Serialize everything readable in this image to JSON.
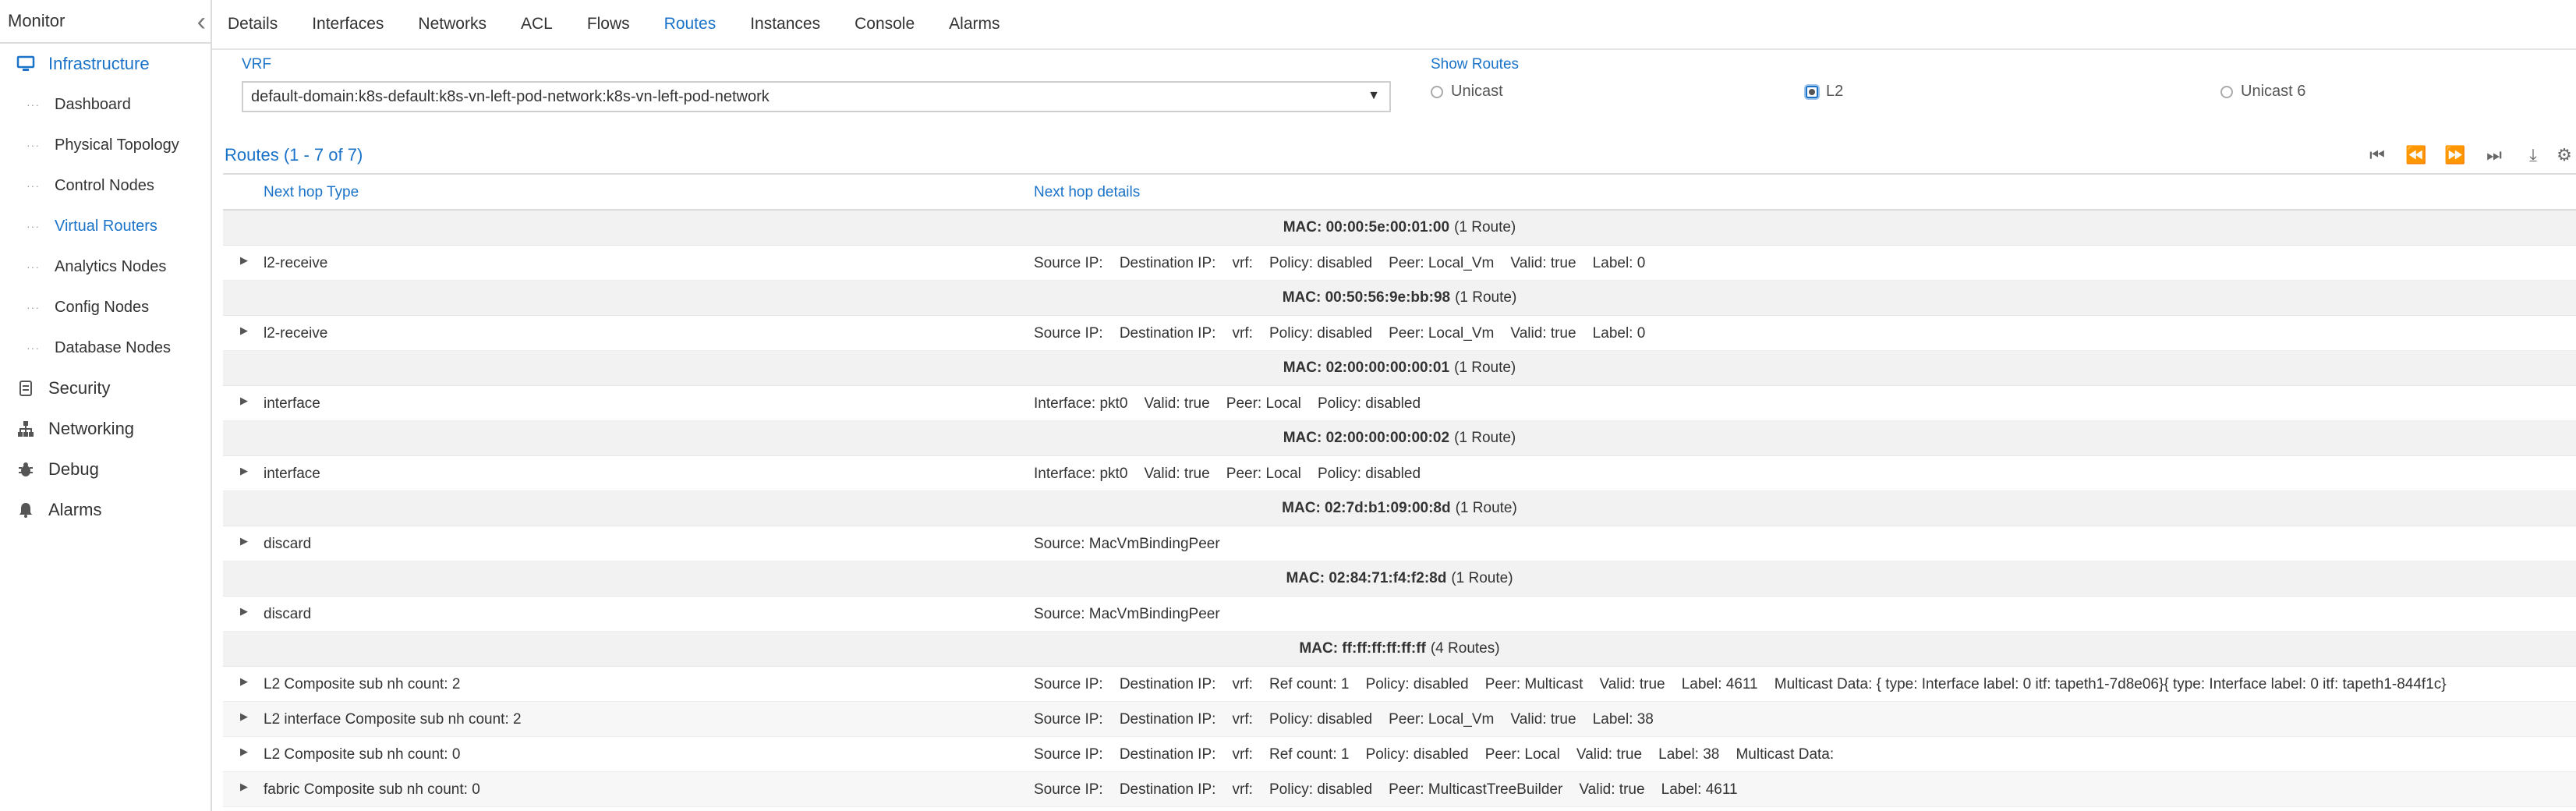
{
  "sidebar": {
    "title": "Monitor",
    "collapse_icon": "chevron-left-icon",
    "infrastructure": "Infrastructure",
    "sub_items": [
      "Dashboard",
      "Physical Topology",
      "Control Nodes",
      "Virtual Routers",
      "Analytics Nodes",
      "Config Nodes",
      "Database Nodes"
    ],
    "sections": [
      "Security",
      "Networking",
      "Debug",
      "Alarms"
    ]
  },
  "tabs": [
    "Details",
    "Interfaces",
    "Networks",
    "ACL",
    "Flows",
    "Routes",
    "Instances",
    "Console",
    "Alarms"
  ],
  "filters": {
    "vrf_label": "VRF",
    "vrf_value": "default-domain:k8s-default:k8s-vn-left-pod-network:k8s-vn-left-pod-network",
    "show_routes_label": "Show Routes",
    "options": [
      "Unicast",
      "L2",
      "Unicast 6"
    ],
    "selected": "L2"
  },
  "grid": {
    "title": "Routes (1 - 7 of 7)",
    "col_type": "Next hop Type",
    "col_details": "Next hop details",
    "groups": [
      {
        "mac": "MAC: 00:00:5e:00:01:00",
        "count": "(1 Route)",
        "rows": [
          {
            "type": "l2-receive",
            "details": "Source IP:    Destination IP:    vrf:    Policy: disabled    Peer: Local_Vm    Valid: true    Label: 0"
          }
        ]
      },
      {
        "mac": "MAC: 00:50:56:9e:bb:98",
        "count": "(1 Route)",
        "rows": [
          {
            "type": "l2-receive",
            "details": "Source IP:    Destination IP:    vrf:    Policy: disabled    Peer: Local_Vm    Valid: true    Label: 0"
          }
        ]
      },
      {
        "mac": "MAC: 02:00:00:00:00:01",
        "count": "(1 Route)",
        "rows": [
          {
            "type": "interface",
            "details": "Interface: pkt0    Valid: true    Peer: Local    Policy: disabled"
          }
        ]
      },
      {
        "mac": "MAC: 02:00:00:00:00:02",
        "count": "(1 Route)",
        "rows": [
          {
            "type": "interface",
            "details": "Interface: pkt0    Valid: true    Peer: Local    Policy: disabled"
          }
        ]
      },
      {
        "mac": "MAC: 02:7d:b1:09:00:8d",
        "count": "(1 Route)",
        "rows": [
          {
            "type": "discard",
            "details": "Source: MacVmBindingPeer"
          }
        ]
      },
      {
        "mac": "MAC: 02:84:71:f4:f2:8d",
        "count": "(1 Route)",
        "rows": [
          {
            "type": "discard",
            "details": "Source: MacVmBindingPeer"
          }
        ]
      },
      {
        "mac": "MAC: ff:ff:ff:ff:ff:ff",
        "count": "(4 Routes)",
        "rows": [
          {
            "type": "L2 Composite sub nh count: 2",
            "details": "Source IP:    Destination IP:    vrf:    Ref count: 1    Policy: disabled    Peer: Multicast    Valid: true    Label: 4611    Multicast Data: { type: Interface label: 0 itf: tapeth1-7d8e06}{ type: Interface label: 0 itf: tapeth1-844f1c}"
          },
          {
            "type": "L2 interface Composite sub nh count: 2",
            "details": "Source IP:    Destination IP:    vrf:    Policy: disabled    Peer: Local_Vm    Valid: true    Label: 38"
          },
          {
            "type": "L2 Composite sub nh count: 0",
            "details": "Source IP:    Destination IP:    vrf:    Ref count: 1    Policy: disabled    Peer: Local    Valid: true    Label: 38    Multicast Data:"
          },
          {
            "type": "fabric Composite sub nh count: 0",
            "details": "Source IP:    Destination IP:    vrf:    Policy: disabled    Peer: MulticastTreeBuilder    Valid: true    Label: 4611"
          }
        ]
      }
    ]
  }
}
